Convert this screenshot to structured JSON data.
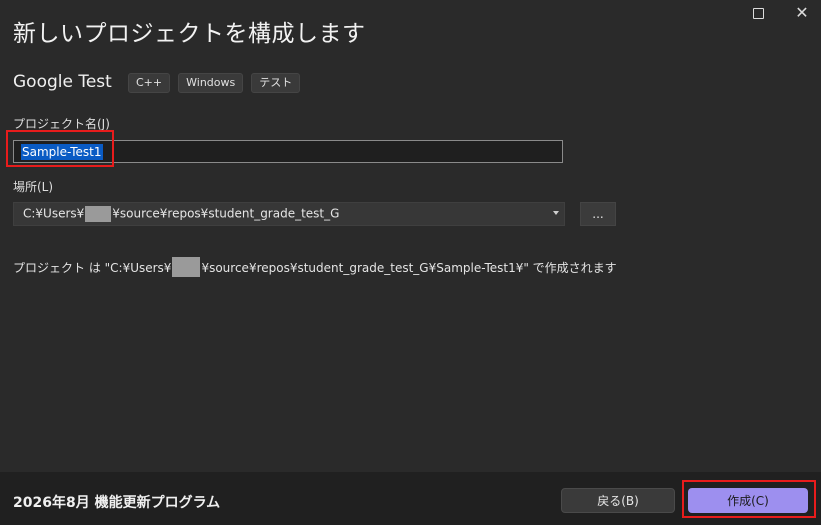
{
  "dialog": {
    "title": "新しいプロジェクトを構成します"
  },
  "window_controls": {
    "maximize_icon": "maximize-icon",
    "close_icon": "close-icon"
  },
  "template": {
    "name": "Google Test",
    "tags": [
      "C++",
      "Windows",
      "テスト"
    ]
  },
  "project_name": {
    "label": "プロジェクト名(J)",
    "value": "Sample-Test1"
  },
  "location": {
    "label": "場所(L)",
    "value_prefix": "C:¥Users¥",
    "value_suffix": "¥source¥repos¥student_grade_test_G",
    "browse_label": "..."
  },
  "info": {
    "prefix": "プロジェクト は \"C:¥Users¥",
    "suffix": "¥source¥repos¥student_grade_test_G¥Sample-Test1¥\" で作成されます"
  },
  "footer": {
    "update_text": "2026年8月 機能更新プログラム",
    "back_label": "戻る(B)",
    "create_label": "作成(C)"
  },
  "colors": {
    "background": "#2a2a2a",
    "footer": "#202020",
    "accent": "#9d8fef",
    "selection": "#0a5bc4",
    "highlight_box": "#e81c1c"
  }
}
